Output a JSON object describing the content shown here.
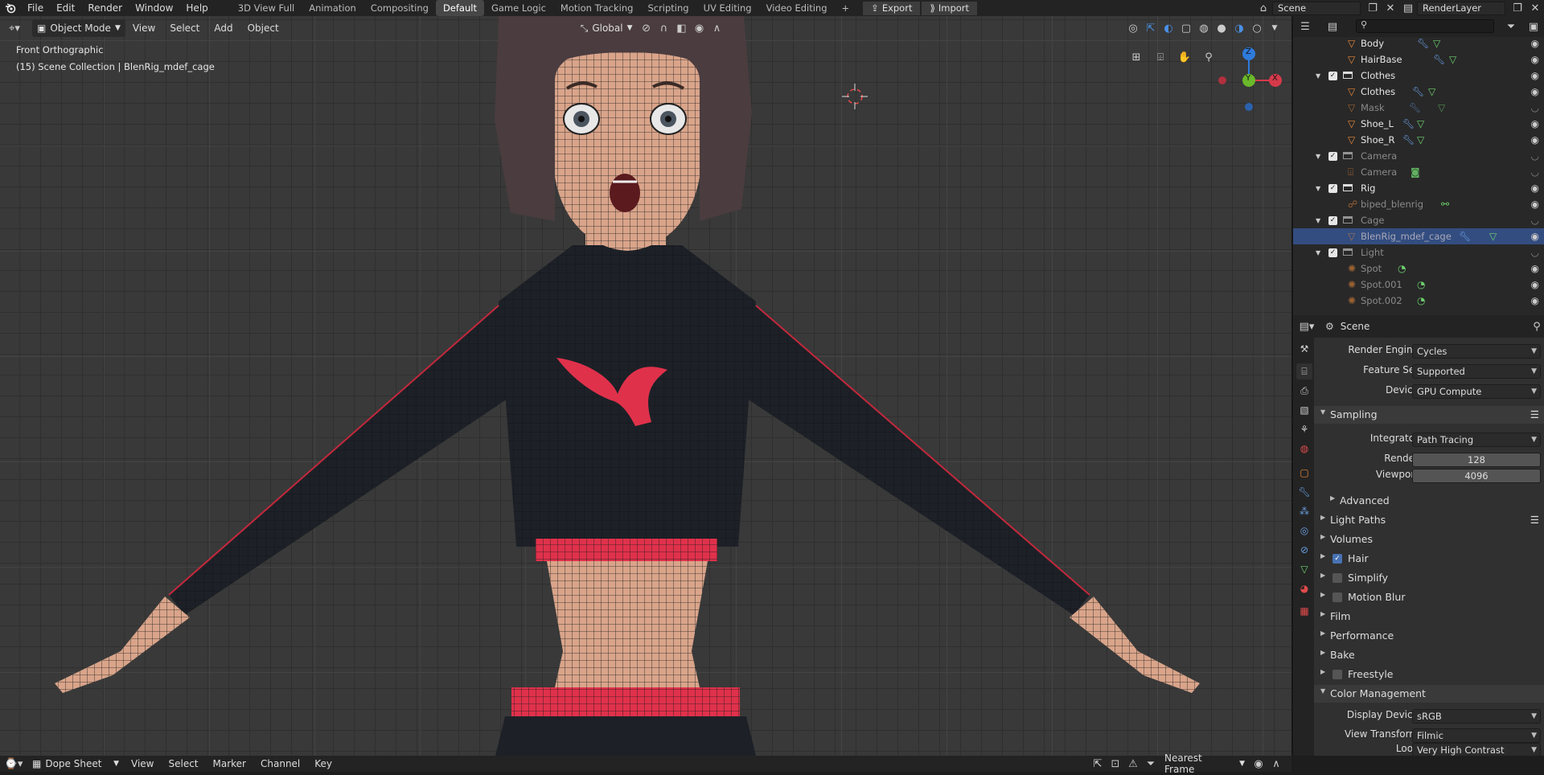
{
  "topbar": {
    "menus": [
      "File",
      "Edit",
      "Render",
      "Window",
      "Help"
    ],
    "workspaces": [
      "3D View Full",
      "Animation",
      "Compositing",
      "Default",
      "Game Logic",
      "Motion Tracking",
      "Scripting",
      "UV Editing",
      "Video Editing"
    ],
    "active_workspace": "Default",
    "add_tab": "+",
    "export_label": "Export",
    "import_label": "Import",
    "scene_name": "Scene",
    "view_layer": "RenderLayer"
  },
  "viewport": {
    "mode": "Object Mode",
    "menus": [
      "View",
      "Select",
      "Add",
      "Object"
    ],
    "orientation": "Global",
    "view_name": "Front Orthographic",
    "collection_info": "(15) Scene Collection | BlenRig_mdef_cage",
    "gizmo": {
      "z": "Z",
      "y": "Y",
      "x": "X"
    }
  },
  "outliner": {
    "search_placeholder": "",
    "rows": [
      {
        "label": "Body",
        "type": "mesh",
        "dim": false
      },
      {
        "label": "HairBase",
        "type": "mesh",
        "dim": false
      },
      {
        "label": "Clothes",
        "type": "collection",
        "dim": false
      },
      {
        "label": "Clothes",
        "type": "mesh",
        "dim": false
      },
      {
        "label": "Mask",
        "type": "mesh",
        "dim": true
      },
      {
        "label": "Shoe_L",
        "type": "mesh",
        "dim": false
      },
      {
        "label": "Shoe_R",
        "type": "mesh",
        "dim": false
      },
      {
        "label": "Camera",
        "type": "collection",
        "dim": true
      },
      {
        "label": "Camera",
        "type": "camera",
        "dim": true
      },
      {
        "label": "Rig",
        "type": "collection",
        "dim": false
      },
      {
        "label": "biped_blenrig",
        "type": "armature",
        "dim": true
      },
      {
        "label": "Cage",
        "type": "collection",
        "dim": true
      },
      {
        "label": "BlenRig_mdef_cage",
        "type": "mesh",
        "dim": true,
        "selected": true
      },
      {
        "label": "Light",
        "type": "collection",
        "dim": true
      },
      {
        "label": "Spot",
        "type": "light",
        "dim": true
      },
      {
        "label": "Spot.001",
        "type": "light",
        "dim": true
      },
      {
        "label": "Spot.002",
        "type": "light",
        "dim": true
      }
    ]
  },
  "properties": {
    "context": "Scene",
    "render_engine_label": "Render Engine",
    "render_engine": "Cycles",
    "feature_set_label": "Feature Set",
    "feature_set": "Supported",
    "device_label": "Device",
    "device": "GPU Compute",
    "sampling": "Sampling",
    "integrator_label": "Integrator",
    "integrator": "Path Tracing",
    "render_label": "Render",
    "render_samples": "128",
    "viewport_label": "Viewport",
    "viewport_samples": "4096",
    "advanced": "Advanced",
    "light_paths": "Light Paths",
    "volumes": "Volumes",
    "hair": "Hair",
    "simplify": "Simplify",
    "motion_blur": "Motion Blur",
    "film": "Film",
    "performance": "Performance",
    "bake": "Bake",
    "freestyle": "Freestyle",
    "color_management": "Color Management",
    "display_device_label": "Display Device",
    "display_device": "sRGB",
    "view_transform_label": "View Transform",
    "view_transform": "Filmic",
    "look_label": "Look",
    "look": "Very High Contrast"
  },
  "timeline": {
    "editor": "Dope Sheet",
    "menus": [
      "View",
      "Select",
      "Marker",
      "Channel",
      "Key"
    ],
    "snap": "Nearest Frame"
  },
  "colors": {
    "accent": "#4772b3",
    "selection": "#334d80",
    "top_red": "#e0314b"
  }
}
